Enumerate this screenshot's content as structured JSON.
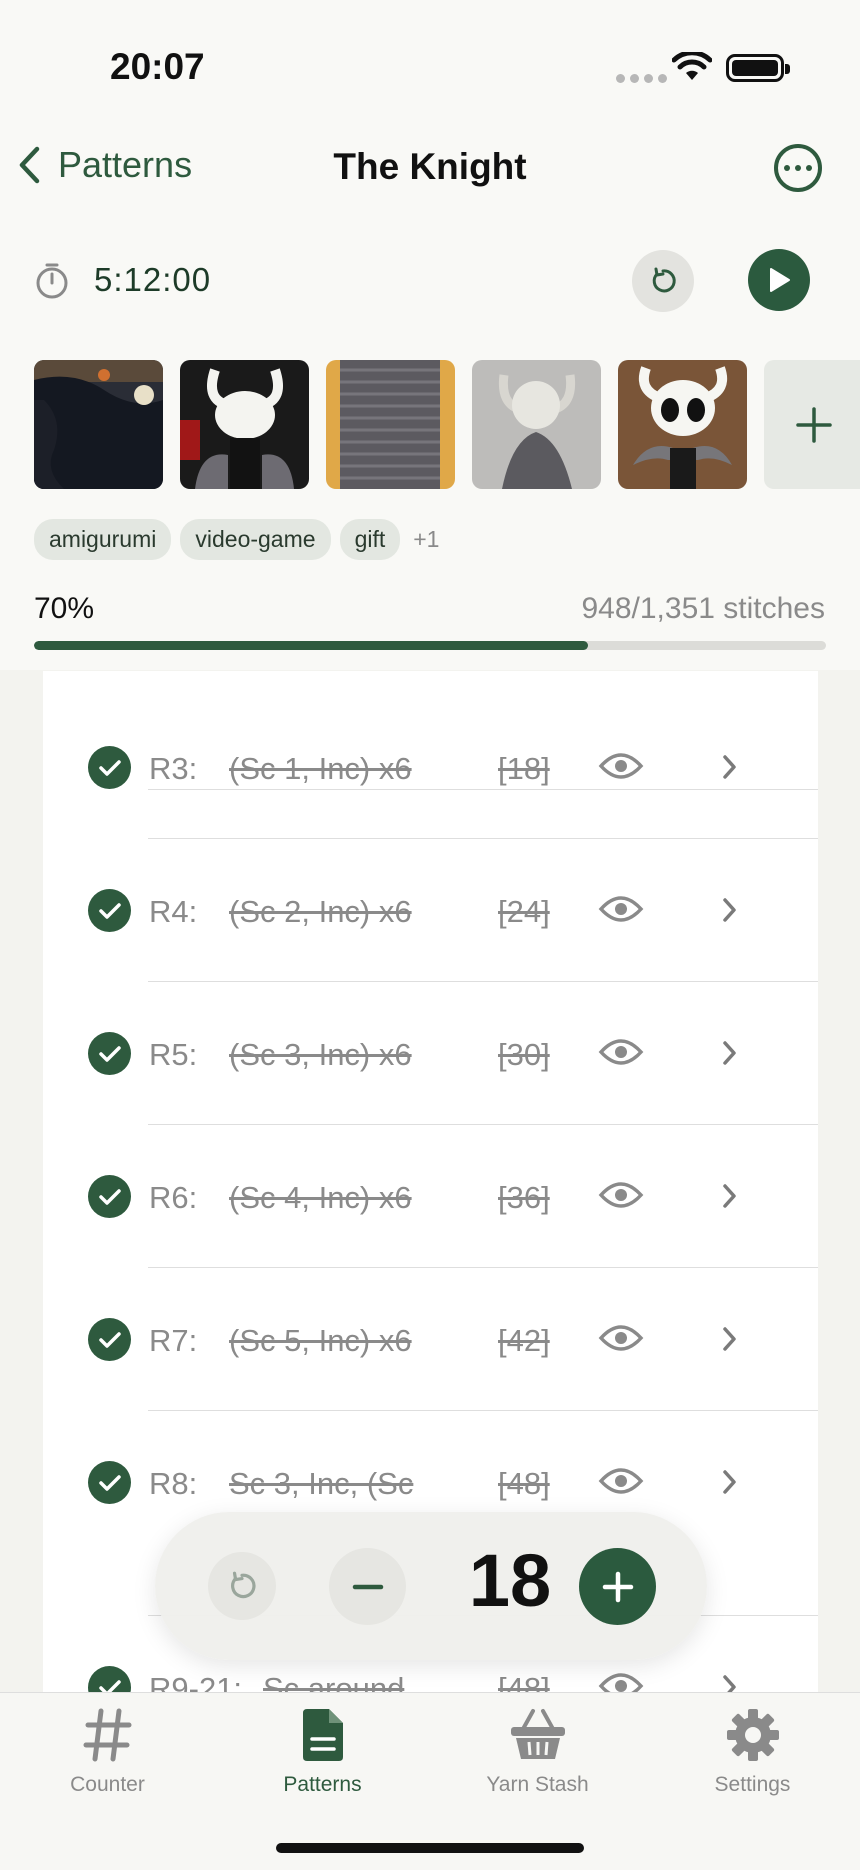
{
  "status_bar": {
    "time": "20:07"
  },
  "nav": {
    "back_label": "Patterns",
    "title": "The Knight"
  },
  "timer": {
    "value": "5:12:00"
  },
  "photos": [
    {
      "icon": "photo-dark-knitted-piece"
    },
    {
      "icon": "photo-knight-head-dark-bg"
    },
    {
      "icon": "photo-gray-knitted-strip"
    },
    {
      "icon": "photo-head-and-cloak"
    },
    {
      "icon": "photo-knight-finished"
    }
  ],
  "tags": [
    "amigurumi",
    "video-game",
    "gift"
  ],
  "tags_more": "+1",
  "progress": {
    "percent_label": "70%",
    "fraction": 0.7,
    "stitches_label": "948/1,351 stitches"
  },
  "rows": [
    {
      "label": "R3:",
      "instruction": "(Sc 1, Inc) x6",
      "count": "[18]"
    },
    {
      "label": "R4:",
      "instruction": "(Sc 2, Inc) x6",
      "count": "[24]"
    },
    {
      "label": "R5:",
      "instruction": "(Sc 3, Inc) x6",
      "count": "[30]"
    },
    {
      "label": "R6:",
      "instruction": "(Sc 4, Inc) x6",
      "count": "[36]"
    },
    {
      "label": "R7:",
      "instruction": "(Sc 5, Inc) x6",
      "count": "[42]"
    },
    {
      "label": "R8:",
      "instruction": "Sc 3, Inc, (Sc",
      "count": "[48]"
    },
    {
      "label": "R9-21:",
      "instruction": "Sc around",
      "count": "[48]"
    }
  ],
  "counter": {
    "value": "18"
  },
  "tabs": [
    {
      "label": "Counter",
      "icon": "hash-icon",
      "active": false
    },
    {
      "label": "Patterns",
      "icon": "document-icon",
      "active": true
    },
    {
      "label": "Yarn Stash",
      "icon": "basket-icon",
      "active": false
    },
    {
      "label": "Settings",
      "icon": "gear-icon",
      "active": false
    }
  ],
  "colors": {
    "accent": "#2e5a3e",
    "muted": "#8a8a8a"
  }
}
